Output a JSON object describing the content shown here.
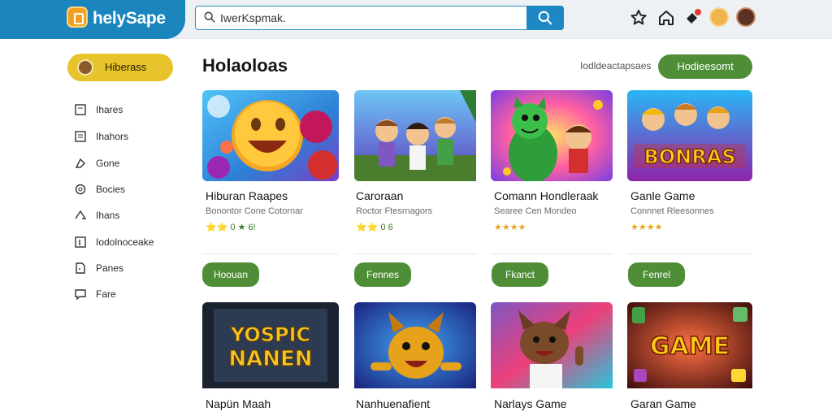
{
  "header": {
    "brand": "helySape",
    "search": {
      "value": "IwerKspmak.",
      "placeholder": ""
    },
    "icons": [
      "star-icon",
      "home-icon",
      "notification-icon",
      "user-avatar-1",
      "user-avatar-2"
    ],
    "notification_badge": ""
  },
  "sidebar": {
    "active": {
      "label": "Hiberass"
    },
    "items": [
      {
        "label": "Ihares",
        "icon": "square-icon"
      },
      {
        "label": "Ihahors",
        "icon": "list-icon"
      },
      {
        "label": "Gone",
        "icon": "tag-icon"
      },
      {
        "label": "Bocies",
        "icon": "circle-icon"
      },
      {
        "label": "Ihans",
        "icon": "flag-icon"
      },
      {
        "label": "Iodolnoceake",
        "icon": "bar-icon"
      },
      {
        "label": "Panes",
        "icon": "page-icon"
      },
      {
        "label": "Fare",
        "icon": "chat-icon"
      }
    ]
  },
  "main": {
    "title": "Holaoloas",
    "view_all": "Iodldeactapsaes",
    "primary_button": "Hodieesomt",
    "row1": [
      {
        "title": "Hiburan Raapes",
        "subtitle": "Bonontor Cone Cotornar",
        "rating": "⭐⭐ 0 ★ 6!",
        "button": "Hoouan",
        "art_text": ""
      },
      {
        "title": "Caroraan",
        "subtitle": "Roctor Ftesrnagors",
        "rating": "⭐⭐ 0 6",
        "button": "Fennes",
        "art_text": ""
      },
      {
        "title": "Comann Hondleraak",
        "subtitle": "Searee Cen Mondeo",
        "rating": "★★★★",
        "button": "Fkanct",
        "art_text": ""
      },
      {
        "title": "Ganle Game",
        "subtitle": "Connnet Rleesonnes",
        "rating": "★★★★",
        "button": "Fenrel",
        "art_text": "BONRAS"
      }
    ],
    "row2": [
      {
        "title": "Napün Maah",
        "art_text_1": "YOSPIC",
        "art_text_2": "NANEN"
      },
      {
        "title": "Nanhuenafient",
        "art_text_1": "",
        "art_text_2": ""
      },
      {
        "title": "Narlays Game",
        "art_text_1": "",
        "art_text_2": ""
      },
      {
        "title": "Garan Game",
        "art_text_1": "GAME",
        "art_text_2": ""
      }
    ]
  },
  "colors": {
    "brand": "#1a86bd",
    "accent_green": "#4f8e37",
    "active_pill": "#e7c42b"
  }
}
